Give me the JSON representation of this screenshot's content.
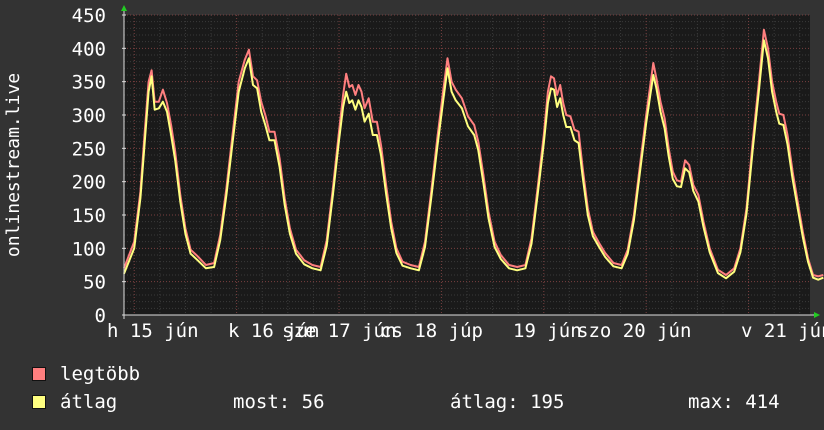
{
  "chart_data": {
    "type": "line",
    "ylabel": "onlinestream.live",
    "ylim": [
      0,
      450
    ],
    "y_ticks": [
      0,
      50,
      100,
      150,
      200,
      250,
      300,
      350,
      400,
      450
    ],
    "grid": true,
    "x_tick_labels": [
      "h 15 jún",
      "k 16 jún",
      "sze 17 jún",
      "cs 18 júp",
      "19 jún",
      "szo 20 jún",
      "v 21 jún"
    ],
    "x_range_days": [
      14.9,
      21.6
    ],
    "colors": {
      "background": "#333333",
      "plot_bg": "#1a1a1a",
      "grid": "#595959",
      "legtobb": "#ff7f7f",
      "atlag": "#ffff80",
      "axis_arrow": "#22cc22",
      "text": "#ffffff"
    },
    "series": [
      {
        "name": "legtöbb",
        "color": "#ff7f7f",
        "points": [
          [
            14.9,
            70
          ],
          [
            15.0,
            110
          ],
          [
            15.06,
            185
          ],
          [
            15.1,
            270
          ],
          [
            15.14,
            350
          ],
          [
            15.17,
            367
          ],
          [
            15.2,
            320
          ],
          [
            15.24,
            320
          ],
          [
            15.28,
            338
          ],
          [
            15.32,
            318
          ],
          [
            15.36,
            285
          ],
          [
            15.4,
            245
          ],
          [
            15.45,
            180
          ],
          [
            15.5,
            130
          ],
          [
            15.55,
            98
          ],
          [
            15.62,
            88
          ],
          [
            15.7,
            75
          ],
          [
            15.78,
            78
          ],
          [
            15.84,
            120
          ],
          [
            15.9,
            190
          ],
          [
            15.96,
            270
          ],
          [
            16.02,
            350
          ],
          [
            16.08,
            383
          ],
          [
            16.12,
            398
          ],
          [
            16.16,
            358
          ],
          [
            16.2,
            352
          ],
          [
            16.24,
            320
          ],
          [
            16.28,
            300
          ],
          [
            16.32,
            275
          ],
          [
            16.37,
            275
          ],
          [
            16.42,
            235
          ],
          [
            16.47,
            175
          ],
          [
            16.52,
            130
          ],
          [
            16.58,
            98
          ],
          [
            16.66,
            82
          ],
          [
            16.74,
            75
          ],
          [
            16.82,
            72
          ],
          [
            16.88,
            112
          ],
          [
            16.94,
            190
          ],
          [
            17.0,
            275
          ],
          [
            17.04,
            330
          ],
          [
            17.07,
            362
          ],
          [
            17.1,
            342
          ],
          [
            17.13,
            345
          ],
          [
            17.16,
            330
          ],
          [
            17.19,
            345
          ],
          [
            17.22,
            335
          ],
          [
            17.25,
            310
          ],
          [
            17.29,
            325
          ],
          [
            17.33,
            290
          ],
          [
            17.37,
            290
          ],
          [
            17.41,
            255
          ],
          [
            17.46,
            195
          ],
          [
            17.51,
            140
          ],
          [
            17.56,
            100
          ],
          [
            17.62,
            80
          ],
          [
            17.7,
            75
          ],
          [
            17.78,
            72
          ],
          [
            17.84,
            110
          ],
          [
            17.9,
            185
          ],
          [
            17.96,
            265
          ],
          [
            18.02,
            340
          ],
          [
            18.06,
            385
          ],
          [
            18.1,
            350
          ],
          [
            18.14,
            338
          ],
          [
            18.2,
            325
          ],
          [
            18.26,
            298
          ],
          [
            18.32,
            285
          ],
          [
            18.36,
            260
          ],
          [
            18.41,
            210
          ],
          [
            18.46,
            155
          ],
          [
            18.52,
            110
          ],
          [
            18.58,
            90
          ],
          [
            18.66,
            75
          ],
          [
            18.74,
            72
          ],
          [
            18.82,
            75
          ],
          [
            18.88,
            115
          ],
          [
            18.94,
            190
          ],
          [
            19.0,
            270
          ],
          [
            19.04,
            335
          ],
          [
            19.07,
            358
          ],
          [
            19.1,
            355
          ],
          [
            19.13,
            330
          ],
          [
            19.16,
            345
          ],
          [
            19.19,
            318
          ],
          [
            19.22,
            300
          ],
          [
            19.26,
            298
          ],
          [
            19.3,
            278
          ],
          [
            19.34,
            275
          ],
          [
            19.38,
            220
          ],
          [
            19.43,
            160
          ],
          [
            19.48,
            125
          ],
          [
            19.54,
            108
          ],
          [
            19.6,
            93
          ],
          [
            19.68,
            78
          ],
          [
            19.76,
            75
          ],
          [
            19.82,
            98
          ],
          [
            19.88,
            150
          ],
          [
            19.94,
            225
          ],
          [
            20.0,
            300
          ],
          [
            20.04,
            345
          ],
          [
            20.07,
            378
          ],
          [
            20.1,
            355
          ],
          [
            20.14,
            320
          ],
          [
            20.18,
            295
          ],
          [
            20.22,
            250
          ],
          [
            20.26,
            215
          ],
          [
            20.3,
            202
          ],
          [
            20.34,
            200
          ],
          [
            20.38,
            232
          ],
          [
            20.42,
            225
          ],
          [
            20.46,
            195
          ],
          [
            20.51,
            180
          ],
          [
            20.56,
            140
          ],
          [
            20.62,
            100
          ],
          [
            20.7,
            68
          ],
          [
            20.78,
            60
          ],
          [
            20.86,
            70
          ],
          [
            20.92,
            100
          ],
          [
            20.98,
            160
          ],
          [
            21.04,
            260
          ],
          [
            21.1,
            348
          ],
          [
            21.15,
            428
          ],
          [
            21.19,
            400
          ],
          [
            21.23,
            350
          ],
          [
            21.27,
            320
          ],
          [
            21.3,
            302
          ],
          [
            21.34,
            300
          ],
          [
            21.38,
            270
          ],
          [
            21.43,
            215
          ],
          [
            21.48,
            170
          ],
          [
            21.53,
            125
          ],
          [
            21.58,
            85
          ],
          [
            21.63,
            60
          ],
          [
            21.68,
            58
          ],
          [
            21.73,
            60
          ]
        ]
      },
      {
        "name": "átlag",
        "color": "#ffff80",
        "points": [
          [
            14.9,
            62
          ],
          [
            15.0,
            100
          ],
          [
            15.06,
            175
          ],
          [
            15.1,
            255
          ],
          [
            15.14,
            335
          ],
          [
            15.17,
            358
          ],
          [
            15.2,
            308
          ],
          [
            15.24,
            310
          ],
          [
            15.28,
            320
          ],
          [
            15.32,
            305
          ],
          [
            15.36,
            270
          ],
          [
            15.4,
            232
          ],
          [
            15.45,
            170
          ],
          [
            15.5,
            122
          ],
          [
            15.55,
            92
          ],
          [
            15.62,
            82
          ],
          [
            15.7,
            70
          ],
          [
            15.78,
            72
          ],
          [
            15.84,
            112
          ],
          [
            15.9,
            180
          ],
          [
            15.96,
            258
          ],
          [
            16.02,
            335
          ],
          [
            16.08,
            370
          ],
          [
            16.12,
            385
          ],
          [
            16.16,
            345
          ],
          [
            16.2,
            340
          ],
          [
            16.24,
            305
          ],
          [
            16.28,
            285
          ],
          [
            16.32,
            262
          ],
          [
            16.37,
            262
          ],
          [
            16.42,
            222
          ],
          [
            16.47,
            165
          ],
          [
            16.52,
            122
          ],
          [
            16.58,
            92
          ],
          [
            16.66,
            76
          ],
          [
            16.74,
            70
          ],
          [
            16.82,
            67
          ],
          [
            16.88,
            104
          ],
          [
            16.94,
            180
          ],
          [
            17.0,
            262
          ],
          [
            17.04,
            312
          ],
          [
            17.07,
            335
          ],
          [
            17.1,
            318
          ],
          [
            17.13,
            322
          ],
          [
            17.16,
            308
          ],
          [
            17.19,
            322
          ],
          [
            17.22,
            312
          ],
          [
            17.25,
            290
          ],
          [
            17.29,
            302
          ],
          [
            17.33,
            270
          ],
          [
            17.37,
            270
          ],
          [
            17.41,
            240
          ],
          [
            17.46,
            182
          ],
          [
            17.51,
            130
          ],
          [
            17.56,
            93
          ],
          [
            17.62,
            74
          ],
          [
            17.7,
            70
          ],
          [
            17.78,
            67
          ],
          [
            17.84,
            102
          ],
          [
            17.9,
            175
          ],
          [
            17.96,
            252
          ],
          [
            18.02,
            325
          ],
          [
            18.06,
            370
          ],
          [
            18.1,
            335
          ],
          [
            18.14,
            322
          ],
          [
            18.2,
            310
          ],
          [
            18.26,
            283
          ],
          [
            18.32,
            270
          ],
          [
            18.36,
            247
          ],
          [
            18.41,
            198
          ],
          [
            18.46,
            145
          ],
          [
            18.52,
            102
          ],
          [
            18.58,
            84
          ],
          [
            18.66,
            70
          ],
          [
            18.74,
            67
          ],
          [
            18.82,
            70
          ],
          [
            18.88,
            107
          ],
          [
            18.94,
            180
          ],
          [
            19.0,
            258
          ],
          [
            19.04,
            318
          ],
          [
            19.07,
            340
          ],
          [
            19.1,
            338
          ],
          [
            19.13,
            312
          ],
          [
            19.16,
            325
          ],
          [
            19.19,
            300
          ],
          [
            19.22,
            282
          ],
          [
            19.26,
            282
          ],
          [
            19.3,
            262
          ],
          [
            19.34,
            258
          ],
          [
            19.38,
            207
          ],
          [
            19.43,
            150
          ],
          [
            19.48,
            118
          ],
          [
            19.54,
            102
          ],
          [
            19.6,
            87
          ],
          [
            19.68,
            73
          ],
          [
            19.76,
            70
          ],
          [
            19.82,
            92
          ],
          [
            19.88,
            142
          ],
          [
            19.94,
            215
          ],
          [
            20.0,
            288
          ],
          [
            20.04,
            330
          ],
          [
            20.07,
            360
          ],
          [
            20.1,
            340
          ],
          [
            20.14,
            305
          ],
          [
            20.18,
            280
          ],
          [
            20.22,
            238
          ],
          [
            20.26,
            204
          ],
          [
            20.3,
            193
          ],
          [
            20.34,
            192
          ],
          [
            20.38,
            220
          ],
          [
            20.42,
            214
          ],
          [
            20.46,
            186
          ],
          [
            20.51,
            170
          ],
          [
            20.56,
            132
          ],
          [
            20.62,
            94
          ],
          [
            20.7,
            63
          ],
          [
            20.78,
            55
          ],
          [
            20.86,
            65
          ],
          [
            20.92,
            94
          ],
          [
            20.98,
            152
          ],
          [
            21.04,
            248
          ],
          [
            21.1,
            335
          ],
          [
            21.15,
            412
          ],
          [
            21.19,
            385
          ],
          [
            21.23,
            335
          ],
          [
            21.27,
            305
          ],
          [
            21.3,
            287
          ],
          [
            21.34,
            285
          ],
          [
            21.38,
            256
          ],
          [
            21.43,
            204
          ],
          [
            21.48,
            160
          ],
          [
            21.53,
            117
          ],
          [
            21.58,
            80
          ],
          [
            21.63,
            56
          ],
          [
            21.68,
            53
          ],
          [
            21.73,
            56
          ]
        ]
      }
    ]
  },
  "legend": {
    "items": [
      {
        "label": "legtöbb",
        "color": "#ff7f7f"
      },
      {
        "label": "átlag",
        "color": "#ffff80"
      }
    ]
  },
  "stats": {
    "current": "most: 56",
    "average": "átlag: 195",
    "max": "max: 414"
  }
}
